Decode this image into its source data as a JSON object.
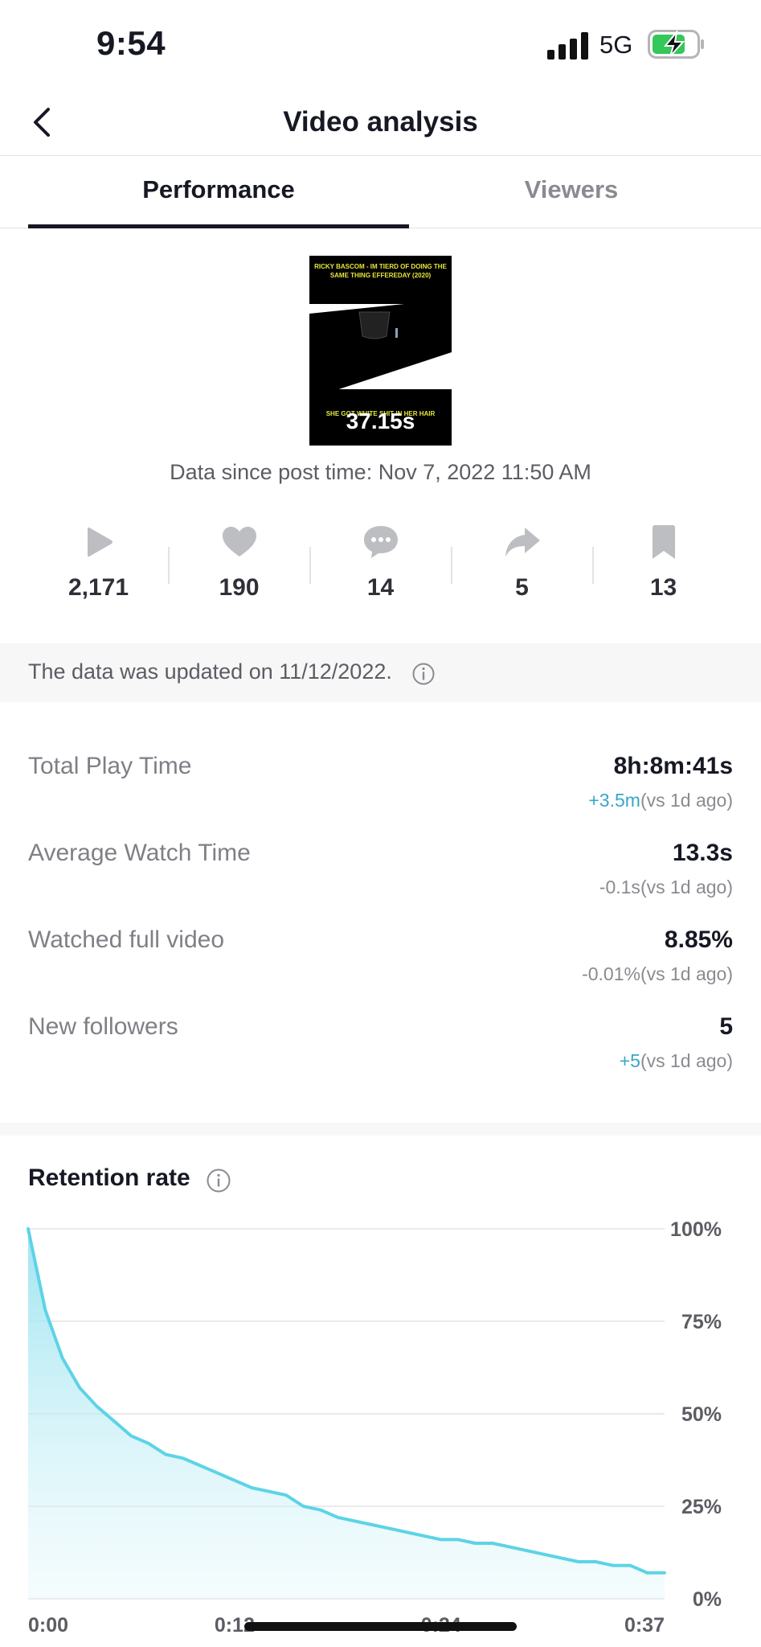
{
  "status_bar": {
    "time": "9:54",
    "network": "5G"
  },
  "header": {
    "title": "Video analysis"
  },
  "tabs": [
    {
      "label": "Performance"
    },
    {
      "label": "Viewers"
    }
  ],
  "video": {
    "caption_top": "RICKY BASCOM - IM TIERD OF DOING THE SAME THING EFFEREDAY (2020)",
    "caption_bottom": "SHE GOT WHITE SHIT IN HER HAIR",
    "duration": "37.15s"
  },
  "data_since": "Data since post time: Nov 7, 2022 11:50 AM",
  "stats": [
    {
      "icon": "play-icon",
      "value": "2,171"
    },
    {
      "icon": "heart-icon",
      "value": "190"
    },
    {
      "icon": "comment-icon",
      "value": "14"
    },
    {
      "icon": "share-icon",
      "value": "5"
    },
    {
      "icon": "bookmark-icon",
      "value": "13"
    }
  ],
  "update_notice": "The data was updated on 11/12/2022.",
  "metrics": [
    {
      "label": "Total Play Time",
      "value": "8h:8m:41s",
      "delta": "+3.5m",
      "delta_suffix": "(vs 1d ago)"
    },
    {
      "label": "Average Watch Time",
      "value": "13.3s",
      "delta": "-0.1s",
      "delta_suffix": "(vs 1d ago)"
    },
    {
      "label": "Watched full video",
      "value": "8.85%",
      "delta": "-0.01%",
      "delta_suffix": "(vs 1d ago)"
    },
    {
      "label": "New followers",
      "value": "5",
      "delta": "+5",
      "delta_suffix": "(vs 1d ago)"
    }
  ],
  "colors": {
    "positive": "#3aa6c7",
    "line": "#5dd3e6",
    "fill": "#a6e8f2"
  },
  "retention": {
    "title": "Retention rate",
    "chart_data": {
      "type": "area",
      "y_ticks": [
        "100%",
        "75%",
        "50%",
        "25%",
        "0%"
      ],
      "x_ticks": [
        "0:00",
        "0:12",
        "0:24",
        "0:37"
      ],
      "ylim": [
        0,
        100
      ],
      "xlim": [
        0,
        37
      ],
      "grid": true,
      "x": [
        0,
        1,
        2,
        3,
        4,
        5,
        6,
        7,
        8,
        9,
        10,
        11,
        12,
        13,
        14,
        15,
        16,
        17,
        18,
        19,
        20,
        21,
        22,
        23,
        24,
        25,
        26,
        27,
        28,
        29,
        30,
        31,
        32,
        33,
        34,
        35,
        36,
        37
      ],
      "y": [
        100,
        78,
        65,
        57,
        52,
        48,
        44,
        42,
        39,
        38,
        36,
        34,
        32,
        30,
        29,
        28,
        25,
        24,
        22,
        21,
        20,
        19,
        18,
        17,
        16,
        16,
        15,
        15,
        14,
        13,
        12,
        11,
        10,
        10,
        9,
        9,
        7,
        7
      ]
    }
  }
}
